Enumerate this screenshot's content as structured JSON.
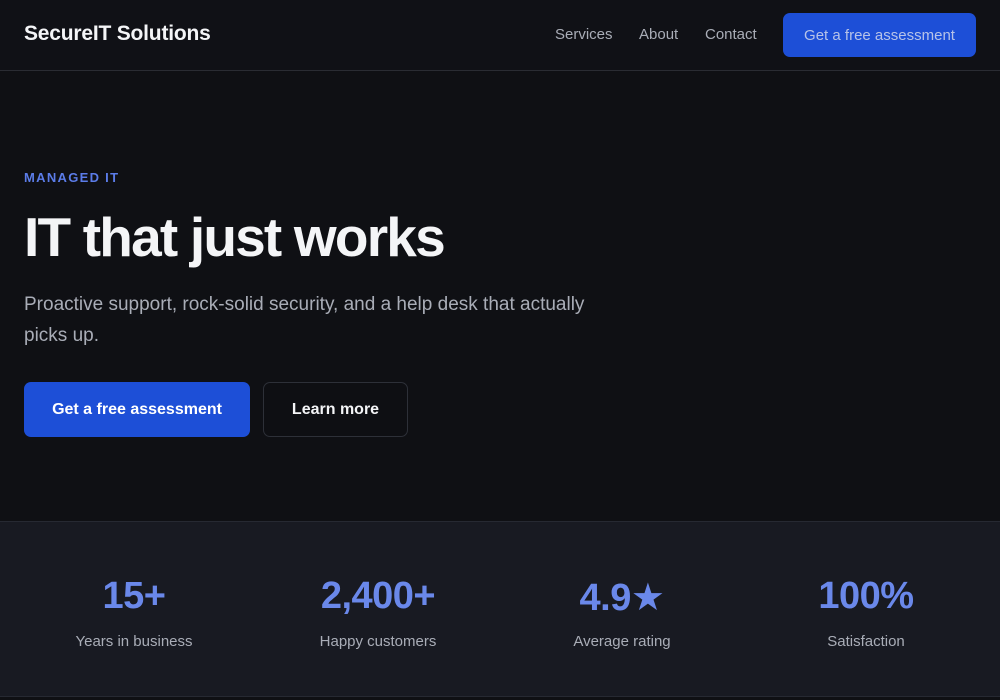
{
  "header": {
    "brand": "SecureIT Solutions",
    "nav": [
      {
        "label": "Services"
      },
      {
        "label": "About"
      },
      {
        "label": "Contact"
      }
    ],
    "cta_label": "Get a free assessment"
  },
  "hero": {
    "eyebrow": "MANAGED IT",
    "title": "IT that just works",
    "subtitle": "Proactive support, rock-solid security, and a help desk that actually picks up.",
    "primary_button": "Get a free assessment",
    "secondary_button": "Learn more"
  },
  "stats": [
    {
      "value": "15+",
      "label": "Years in business"
    },
    {
      "value": "2,400+",
      "label": "Happy customers"
    },
    {
      "value": "4.9★",
      "label": "Average rating"
    },
    {
      "value": "100%",
      "label": "Satisfaction"
    }
  ],
  "colors": {
    "background": "#0f1014",
    "accent": "#1d4fd7",
    "accent_text": "#6a88ea",
    "muted_text": "#a9adb7"
  }
}
